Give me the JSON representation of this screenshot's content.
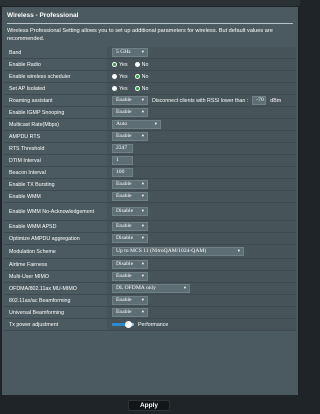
{
  "page": {
    "title": "Wireless - Professional",
    "description": "Wireless Professional Setting allows you to set up additional parameters for wireless. But default values are recommended.",
    "apply_label": "Apply"
  },
  "colors": {
    "panel": "#4b5a60",
    "value_bg": "#46545a",
    "radio_selected": "#2a9d3b",
    "slider": "#2d8ad0"
  },
  "rows": {
    "band": {
      "label": "Band",
      "value": "5 GHz"
    },
    "enable_radio": {
      "label": "Enable Radio",
      "yes": "Yes",
      "no": "No"
    },
    "enable_scheduler": {
      "label": "Enable wireless scheduler",
      "yes": "Yes",
      "no": "No"
    },
    "ap_isolated": {
      "label": "Set AP Isolated",
      "yes": "Yes",
      "no": "No"
    },
    "roaming": {
      "label": "Roaming assistant",
      "value": "Enable",
      "text": "Disconnect clients with RSSI lower than :",
      "rssi": "-70",
      "unit": "dBm"
    },
    "igmp": {
      "label": "Enable IGMP Snooping",
      "value": "Enable"
    },
    "multicast": {
      "label": "Multicast Rate(Mbps)",
      "value": "Auto"
    },
    "ampdu_rts": {
      "label": "AMPDU RTS",
      "value": "Enable"
    },
    "rts_threshold": {
      "label": "RTS Threshold",
      "value": "2347"
    },
    "dtim": {
      "label": "DTIM Interval",
      "value": "1"
    },
    "beacon": {
      "label": "Beacon Interval",
      "value": "100"
    },
    "tx_bursting": {
      "label": "Enable TX Bursting",
      "value": "Enable"
    },
    "wmm": {
      "label": "Enable WMM",
      "value": "Enable"
    },
    "wmm_noack": {
      "label": "Enable WMM No-Acknowledgement",
      "value": "Disable"
    },
    "wmm_apsd": {
      "label": "Enable WMM APSD",
      "value": "Enable"
    },
    "ampdu_agg": {
      "label": "Optimize AMPDU aggregation",
      "value": "Disable"
    },
    "modulation": {
      "label": "Modulation Scheme",
      "value": "Up to MCS 11 (NitroQAM/1024-QAM)"
    },
    "airtime": {
      "label": "Airtime Fairness",
      "value": "Disable"
    },
    "mu_mimo": {
      "label": "Multi-User MIMO",
      "value": "Enable"
    },
    "ofdma": {
      "label": "OFDMA/802.11ax MU-MIMO",
      "value": "DL OFDMA only"
    },
    "beamforming_ac": {
      "label": "802.11ax/ac Beamforming",
      "value": "Enable"
    },
    "beamforming_univ": {
      "label": "Universal Beamforming",
      "value": "Enable"
    },
    "tx_power": {
      "label": "Tx power adjustment",
      "value": "Performance",
      "level": 0.75
    }
  },
  "icons": {
    "dropdown": "chevron-down-icon"
  }
}
